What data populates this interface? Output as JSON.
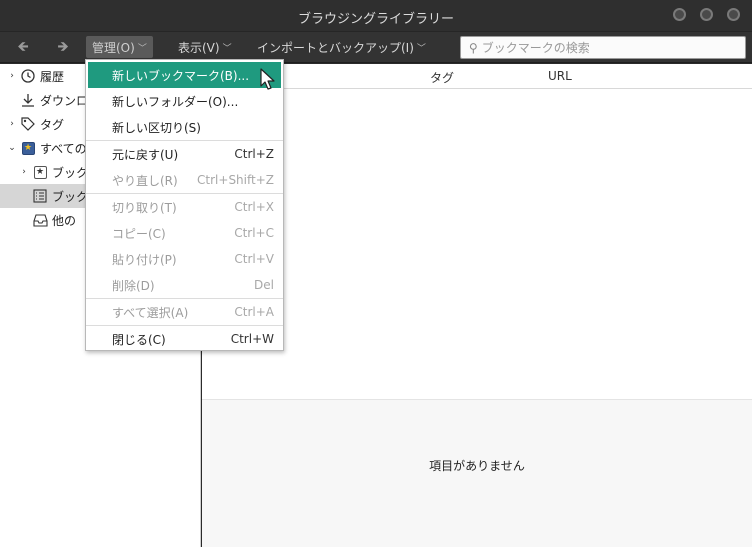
{
  "window": {
    "title": "ブラウジングライブラリー"
  },
  "toolbar": {
    "back_glyph": "🡸",
    "forward_glyph": "🡺",
    "menus": [
      {
        "label": "管理(O)"
      },
      {
        "label": "表示(V)"
      },
      {
        "label": "インポートとバックアップ(I)"
      }
    ],
    "search_placeholder": "ブックマークの検索"
  },
  "sidebar": {
    "items": [
      {
        "label": "履歴",
        "icon": "clock-icon"
      },
      {
        "label": "ダウンロ",
        "icon": "download-icon"
      },
      {
        "label": "タグ",
        "icon": "tag-icon"
      },
      {
        "label": "すべての",
        "icon": "bookmarks-star-icon"
      },
      {
        "label": "ブック",
        "icon": "bookmarks-toolbar-icon"
      },
      {
        "label": "ブック",
        "icon": "bookmarks-menu-icon"
      },
      {
        "label": "他の",
        "icon": "other-bookmarks-icon"
      }
    ]
  },
  "columns": {
    "tag": "タグ",
    "url": "URL"
  },
  "detail": {
    "empty_text": "項目がありません"
  },
  "menu": {
    "items": [
      {
        "label": "新しいブックマーク(B)...",
        "accel": "",
        "state": "highlighted"
      },
      {
        "label": "新しいフォルダー(O)...",
        "accel": "",
        "state": "enabled"
      },
      {
        "label": "新しい区切り(S)",
        "accel": "",
        "state": "enabled"
      },
      {
        "label": "元に戻す(U)",
        "accel": "Ctrl+Z",
        "state": "enabled"
      },
      {
        "label": "やり直し(R)",
        "accel": "Ctrl+Shift+Z",
        "state": "disabled"
      },
      {
        "label": "切り取り(T)",
        "accel": "Ctrl+X",
        "state": "disabled"
      },
      {
        "label": "コピー(C)",
        "accel": "Ctrl+C",
        "state": "disabled"
      },
      {
        "label": "貼り付け(P)",
        "accel": "Ctrl+V",
        "state": "disabled"
      },
      {
        "label": "削除(D)",
        "accel": "Del",
        "state": "disabled"
      },
      {
        "label": "すべて選択(A)",
        "accel": "Ctrl+A",
        "state": "disabled"
      },
      {
        "label": "閉じる(C)",
        "accel": "Ctrl+W",
        "state": "enabled"
      }
    ]
  },
  "colors": {
    "highlight": "#1f9a7f",
    "titlebar": "#2f2f2f",
    "toolbar": "#333333"
  }
}
